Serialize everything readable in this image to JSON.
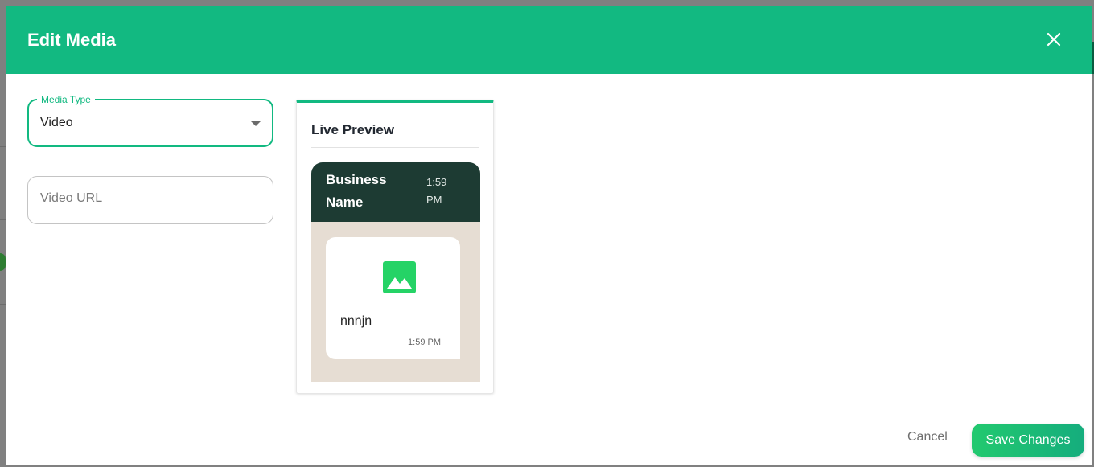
{
  "modal": {
    "title": "Edit Media",
    "close_icon": "close-icon"
  },
  "form": {
    "media_type": {
      "label": "Media Type",
      "value": "Video"
    },
    "video_url": {
      "placeholder": "Video URL",
      "value": ""
    }
  },
  "preview": {
    "title": "Live Preview",
    "business_name": "Business Name",
    "header_time": "1:59 PM",
    "message_text": "nnnjn",
    "message_time": "1:59 PM",
    "media_icon": "image-icon"
  },
  "footer": {
    "cancel_label": "Cancel",
    "save_label": "Save Changes"
  },
  "colors": {
    "accent": "#12b981",
    "preview_header": "#1d3b33",
    "chat_background": "#e6ddd3",
    "media_icon": "#25d366"
  }
}
